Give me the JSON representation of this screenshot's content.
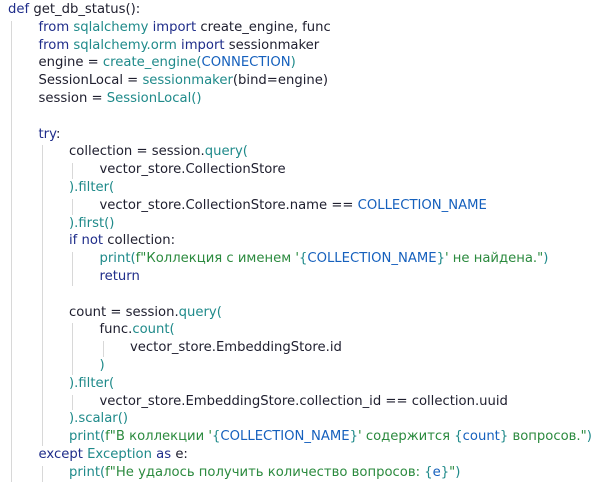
{
  "code_lines": [
    {
      "indent": 0,
      "tokens": [
        {
          "t": "def ",
          "c": "kw"
        },
        {
          "t": "get_db_status",
          "c": "var"
        },
        {
          "t": "():",
          "c": "var"
        }
      ]
    },
    {
      "indent": 1,
      "tokens": [
        {
          "t": "from ",
          "c": "kw"
        },
        {
          "t": "sqlalchemy ",
          "c": "mod"
        },
        {
          "t": "import ",
          "c": "kw"
        },
        {
          "t": "create_engine, func",
          "c": "var"
        }
      ]
    },
    {
      "indent": 1,
      "tokens": [
        {
          "t": "from ",
          "c": "kw"
        },
        {
          "t": "sqlalchemy.orm ",
          "c": "mod"
        },
        {
          "t": "import ",
          "c": "kw"
        },
        {
          "t": "sessionmaker",
          "c": "var"
        }
      ]
    },
    {
      "indent": 1,
      "tokens": [
        {
          "t": "engine = ",
          "c": "var"
        },
        {
          "t": "create_engine",
          "c": "fn"
        },
        {
          "t": "(",
          "c": "fn"
        },
        {
          "t": "CONNECTION",
          "c": "const"
        },
        {
          "t": ")",
          "c": "fn"
        }
      ]
    },
    {
      "indent": 1,
      "tokens": [
        {
          "t": "SessionLocal = ",
          "c": "var"
        },
        {
          "t": "sessionmaker",
          "c": "fn"
        },
        {
          "t": "(bind=engine)",
          "c": "var"
        }
      ]
    },
    {
      "indent": 1,
      "tokens": [
        {
          "t": "session = ",
          "c": "var"
        },
        {
          "t": "SessionLocal",
          "c": "fn"
        },
        {
          "t": "()",
          "c": "fn"
        }
      ]
    },
    {
      "indent": 0,
      "tokens": []
    },
    {
      "indent": 1,
      "tokens": [
        {
          "t": "try",
          "c": "kw"
        },
        {
          "t": ":",
          "c": "var"
        }
      ]
    },
    {
      "indent": 2,
      "tokens": [
        {
          "t": "collection = session.",
          "c": "var"
        },
        {
          "t": "query",
          "c": "fn"
        },
        {
          "t": "(",
          "c": "fn"
        }
      ]
    },
    {
      "indent": 3,
      "tokens": [
        {
          "t": "vector_store.CollectionStore",
          "c": "var"
        }
      ]
    },
    {
      "indent": 2,
      "tokens": [
        {
          "t": ").",
          "c": "fn"
        },
        {
          "t": "filter",
          "c": "fn"
        },
        {
          "t": "(",
          "c": "fn"
        }
      ]
    },
    {
      "indent": 3,
      "tokens": [
        {
          "t": "vector_store.CollectionStore.name == ",
          "c": "var"
        },
        {
          "t": "COLLECTION_NAME",
          "c": "const"
        }
      ]
    },
    {
      "indent": 2,
      "tokens": [
        {
          "t": ").",
          "c": "fn"
        },
        {
          "t": "first",
          "c": "fn"
        },
        {
          "t": "()",
          "c": "fn"
        }
      ]
    },
    {
      "indent": 2,
      "tokens": [
        {
          "t": "if not ",
          "c": "kw"
        },
        {
          "t": "collection:",
          "c": "var"
        }
      ]
    },
    {
      "indent": 3,
      "tokens": [
        {
          "t": "print",
          "c": "fn"
        },
        {
          "t": "(",
          "c": "fn"
        },
        {
          "t": "f\"Коллекция с именем '",
          "c": "str"
        },
        {
          "t": "{",
          "c": "fn"
        },
        {
          "t": "COLLECTION_NAME",
          "c": "const"
        },
        {
          "t": "}",
          "c": "fn"
        },
        {
          "t": "' не найдена.\"",
          "c": "str"
        },
        {
          "t": ")",
          "c": "fn"
        }
      ]
    },
    {
      "indent": 3,
      "tokens": [
        {
          "t": "return",
          "c": "kw"
        }
      ]
    },
    {
      "indent": 0,
      "tokens": []
    },
    {
      "indent": 2,
      "tokens": [
        {
          "t": "count = session.",
          "c": "var"
        },
        {
          "t": "query",
          "c": "fn"
        },
        {
          "t": "(",
          "c": "fn"
        }
      ]
    },
    {
      "indent": 3,
      "tokens": [
        {
          "t": "func.",
          "c": "var"
        },
        {
          "t": "count",
          "c": "fn"
        },
        {
          "t": "(",
          "c": "fn"
        }
      ]
    },
    {
      "indent": 4,
      "tokens": [
        {
          "t": "vector_store.EmbeddingStore.id",
          "c": "var"
        }
      ]
    },
    {
      "indent": 3,
      "tokens": [
        {
          "t": ")",
          "c": "fn"
        }
      ]
    },
    {
      "indent": 2,
      "tokens": [
        {
          "t": ").",
          "c": "fn"
        },
        {
          "t": "filter",
          "c": "fn"
        },
        {
          "t": "(",
          "c": "fn"
        }
      ]
    },
    {
      "indent": 3,
      "tokens": [
        {
          "t": "vector_store.EmbeddingStore.collection_id == collection.uuid",
          "c": "var"
        }
      ]
    },
    {
      "indent": 2,
      "tokens": [
        {
          "t": ").",
          "c": "fn"
        },
        {
          "t": "scalar",
          "c": "fn"
        },
        {
          "t": "()",
          "c": "fn"
        }
      ]
    },
    {
      "indent": 2,
      "tokens": [
        {
          "t": "print",
          "c": "fn"
        },
        {
          "t": "(",
          "c": "fn"
        },
        {
          "t": "f\"В коллекции '",
          "c": "str"
        },
        {
          "t": "{",
          "c": "fn"
        },
        {
          "t": "COLLECTION_NAME",
          "c": "const"
        },
        {
          "t": "}",
          "c": "fn"
        },
        {
          "t": "' содержится ",
          "c": "str"
        },
        {
          "t": "{",
          "c": "fn"
        },
        {
          "t": "count",
          "c": "const"
        },
        {
          "t": "}",
          "c": "fn"
        },
        {
          "t": " вопросов.\"",
          "c": "str"
        },
        {
          "t": ")",
          "c": "fn"
        }
      ]
    },
    {
      "indent": 1,
      "tokens": [
        {
          "t": "except ",
          "c": "kw"
        },
        {
          "t": "Exception ",
          "c": "mod"
        },
        {
          "t": "as ",
          "c": "kw"
        },
        {
          "t": "e:",
          "c": "var"
        }
      ]
    },
    {
      "indent": 2,
      "tokens": [
        {
          "t": "print",
          "c": "fn"
        },
        {
          "t": "(",
          "c": "fn"
        },
        {
          "t": "f\"Не удалось получить количество вопросов: ",
          "c": "str"
        },
        {
          "t": "{",
          "c": "fn"
        },
        {
          "t": "e",
          "c": "const"
        },
        {
          "t": "}",
          "c": "fn"
        },
        {
          "t": "\"",
          "c": "str"
        },
        {
          "t": ")",
          "c": "fn"
        }
      ]
    }
  ]
}
